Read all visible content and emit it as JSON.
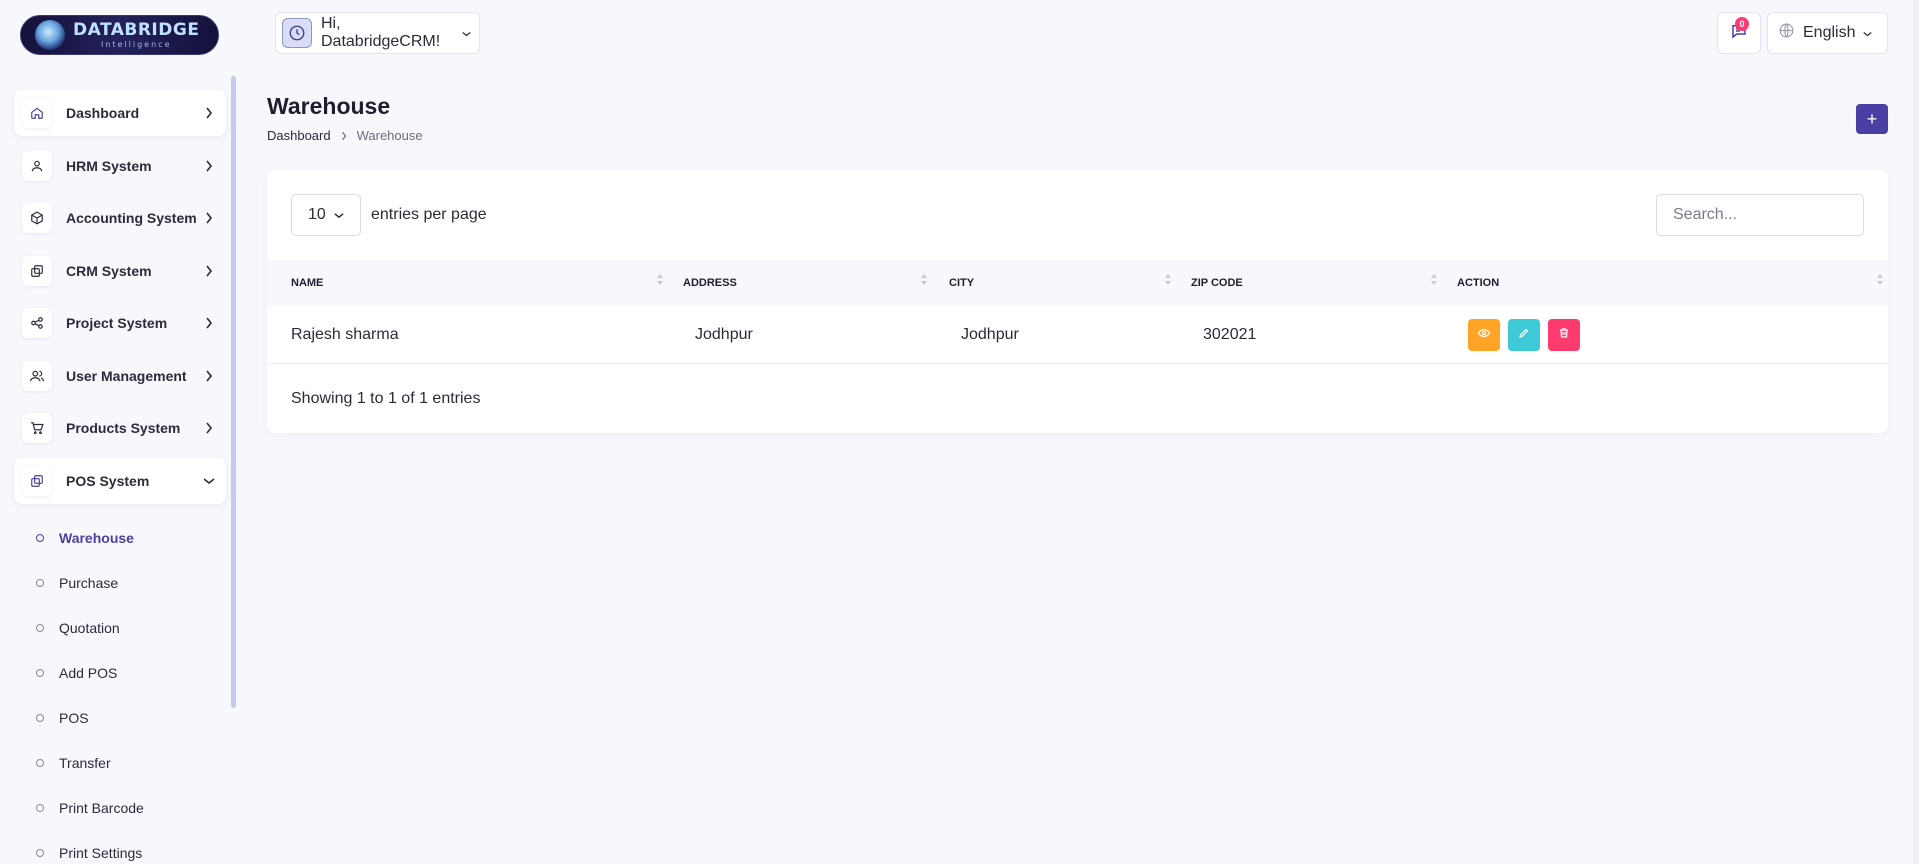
{
  "brand": {
    "name": "DATABRIDGE",
    "tagline": "Intelligence"
  },
  "header": {
    "greeting": "Hi, DatabridgeCRM!",
    "notifications_count": "0",
    "language": "English"
  },
  "sidebar": {
    "items": [
      {
        "label": "Dashboard",
        "icon": "home-icon"
      },
      {
        "label": "HRM System",
        "icon": "user-icon"
      },
      {
        "label": "Accounting System",
        "icon": "box-icon"
      },
      {
        "label": "CRM System",
        "icon": "layers-icon"
      },
      {
        "label": "Project System",
        "icon": "share-icon"
      },
      {
        "label": "User Management",
        "icon": "users-icon"
      },
      {
        "label": "Products System",
        "icon": "cart-icon"
      },
      {
        "label": "POS System",
        "icon": "layers-icon"
      }
    ],
    "pos_sub": [
      "Warehouse",
      "Purchase",
      "Quotation",
      "Add POS",
      "POS",
      "Transfer",
      "Print Barcode",
      "Print Settings"
    ]
  },
  "page": {
    "title": "Warehouse",
    "breadcrumb": [
      "Dashboard",
      "Warehouse"
    ],
    "add_label": "+"
  },
  "table": {
    "per_page": "10",
    "per_page_label": "entries per page",
    "search_placeholder": "Search...",
    "columns": [
      "NAME",
      "ADDRESS",
      "CITY",
      "ZIP CODE",
      "ACTION"
    ],
    "rows": [
      {
        "name": "Rajesh sharma",
        "address": "Jodhpur",
        "city": "Jodhpur",
        "zip": "302021"
      }
    ],
    "info": "Showing 1 to 1 of 1 entries"
  },
  "colors": {
    "accent": "#4b3fa3",
    "view": "#ffa424",
    "edit": "#3ec9d6",
    "delete": "#ff3a6e"
  }
}
